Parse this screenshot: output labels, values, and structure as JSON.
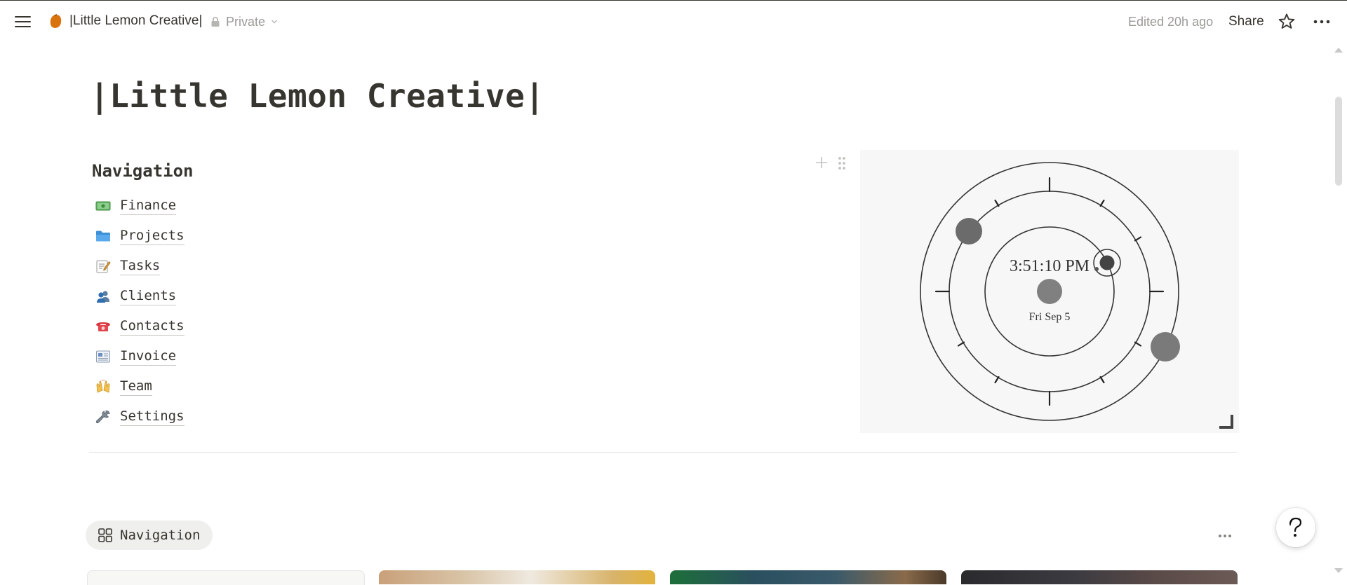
{
  "topbar": {
    "breadcrumb_title": "|Little Lemon Creative|",
    "privacy_label": "Private",
    "edited_text": "Edited 20h ago",
    "share_label": "Share"
  },
  "page": {
    "title": "|Little Lemon Creative|",
    "navigation_heading": "Navigation",
    "nav_items": [
      {
        "emoji": "money-icon",
        "label": "Finance"
      },
      {
        "emoji": "folder-icon",
        "label": "Projects"
      },
      {
        "emoji": "memo-icon",
        "label": "Tasks"
      },
      {
        "emoji": "people-icon",
        "label": "Clients"
      },
      {
        "emoji": "telephone-icon",
        "label": "Contacts"
      },
      {
        "emoji": "newspaper-icon",
        "label": "Invoice"
      },
      {
        "emoji": "raised-hands-icon",
        "label": "Team"
      },
      {
        "emoji": "wrench-icon",
        "label": "Settings"
      }
    ]
  },
  "clock_widget": {
    "time": "3:51:10 PM",
    "date": "Fri Sep 5"
  },
  "gallery": {
    "view_tab_label": "Navigation",
    "cards": [
      "card-1",
      "card-2",
      "card-3",
      "card-4"
    ]
  },
  "colors": {
    "text": "#37352f",
    "muted": "#9b9a97",
    "widget_bg": "#f7f7f7",
    "page_icon": "#d9730d"
  }
}
